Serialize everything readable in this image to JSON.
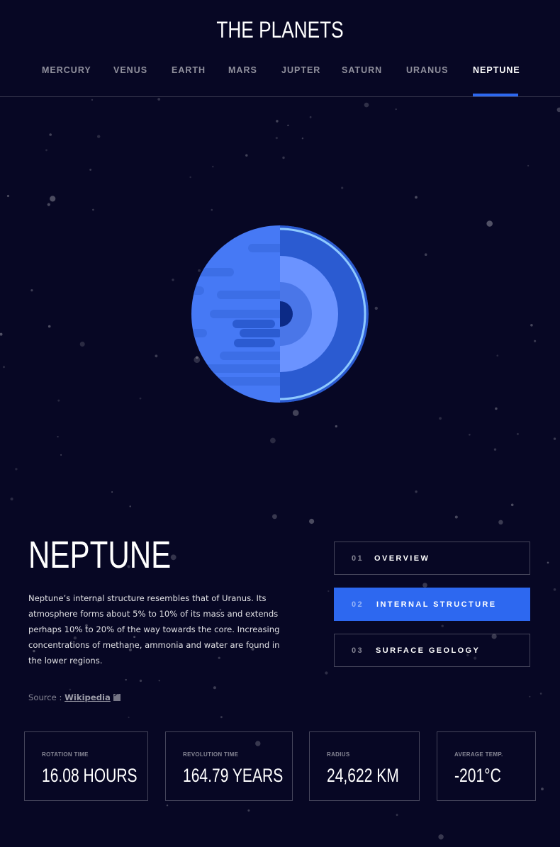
{
  "app": {
    "title": "THE PLANETS"
  },
  "nav": {
    "items": [
      {
        "label": "MERCURY"
      },
      {
        "label": "VENUS"
      },
      {
        "label": "EARTH"
      },
      {
        "label": "MARS"
      },
      {
        "label": "JUPTER"
      },
      {
        "label": "SATURN"
      },
      {
        "label": "URANUS"
      },
      {
        "label": "NEPTUNE",
        "active": true
      }
    ]
  },
  "planet": {
    "name": "NEPTUNE",
    "description": "Neptune’s internal structure resembles that of Uranus. Its atmosphere forms about 5% to 10% of its mass and extends perhaps 10% to 20% of the way towards the core. Increasing concentrations of methane, ammonia and water are found in the lower regions.",
    "source_prefix": "Source : ",
    "source_link": "Wikipedia",
    "image_icon": "neptune-internal-structure-illustration"
  },
  "tabs": [
    {
      "num": "01",
      "label": "OVERVIEW"
    },
    {
      "num": "02",
      "label": "INTERNAL STRUCTURE",
      "active": true
    },
    {
      "num": "03",
      "label": "SURFACE GEOLOGY"
    }
  ],
  "stats": [
    {
      "label": "ROTATION TIME",
      "value": "16.08 HOURS"
    },
    {
      "label": "REVOLUTION TIME",
      "value": "164.79 YEARS"
    },
    {
      "label": "RADIUS",
      "value": "24,622 KM"
    },
    {
      "label": "AVERAGE TEMP.",
      "value": "-201°C"
    }
  ],
  "colors": {
    "background": "#070724",
    "accent": "#2d68f0",
    "border": "#38384f",
    "planet_light": "#4679f5",
    "planet_dark": "#2b5bd1"
  }
}
